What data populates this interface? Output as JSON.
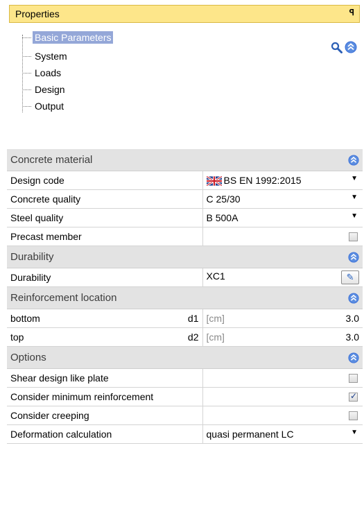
{
  "header": {
    "title": "Properties",
    "pin_icon": "pin-icon"
  },
  "tree": {
    "items": [
      {
        "label": "Basic Parameters",
        "selected": true
      },
      {
        "label": "System",
        "selected": false
      },
      {
        "label": "Loads",
        "selected": false
      },
      {
        "label": "Design",
        "selected": false
      },
      {
        "label": "Output",
        "selected": false
      }
    ]
  },
  "toolbar": {
    "search_icon": "search-icon",
    "collapse_icon": "collapse-all-icon"
  },
  "sections": {
    "concrete": {
      "title": "Concrete material",
      "design_code": {
        "label": "Design code",
        "value": "BS EN 1992:2015",
        "flag": "uk-flag-icon"
      },
      "concrete_quality": {
        "label": "Concrete quality",
        "value": "C 25/30"
      },
      "steel_quality": {
        "label": "Steel quality",
        "value": "B 500A"
      },
      "precast": {
        "label": "Precast member",
        "checked": false
      }
    },
    "durability": {
      "title": "Durability",
      "row": {
        "label": "Durability",
        "value": "XC1"
      }
    },
    "reinforcement": {
      "title": "Reinforcement location",
      "bottom": {
        "label": "bottom",
        "symbol": "d1",
        "unit": "[cm]",
        "value": "3.0"
      },
      "top": {
        "label": "top",
        "symbol": "d2",
        "unit": "[cm]",
        "value": "3.0"
      }
    },
    "options": {
      "title": "Options",
      "shear": {
        "label": "Shear design like plate",
        "checked": false
      },
      "min_reinf": {
        "label": "Consider minimum reinforcement",
        "checked": true
      },
      "creeping": {
        "label": "Consider creeping",
        "checked": false
      },
      "deformation": {
        "label": "Deformation calculation",
        "value": "quasi permanent LC"
      }
    }
  },
  "colors": {
    "header_bg": "#fde68a",
    "selection": "#94a7d8",
    "category_bg": "#e3e3e3",
    "accent": "#3a6fd8"
  }
}
